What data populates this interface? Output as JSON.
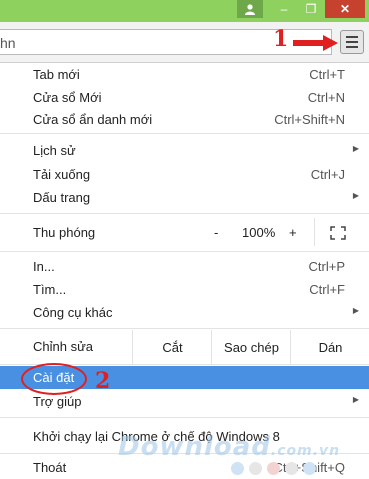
{
  "window": {
    "controls": {
      "minimize": "–",
      "maximize": "❐",
      "close": "✕"
    },
    "colors": {
      "titlebar": "#8fd15f",
      "close": "#c7412f",
      "highlight": "#4a90e2",
      "annotation": "#e02020"
    }
  },
  "omnibox": {
    "text": "hn"
  },
  "annotations": {
    "step1": "1",
    "step2": "2"
  },
  "menu": {
    "new_tab": {
      "label": "Tab mới",
      "shortcut": "Ctrl+T"
    },
    "new_window": {
      "label": "Cửa sổ Mới",
      "shortcut": "Ctrl+N"
    },
    "incognito": {
      "label": "Cửa sổ ẩn danh mới",
      "shortcut": "Ctrl+Shift+N"
    },
    "history": {
      "label": "Lịch sử"
    },
    "downloads": {
      "label": "Tải xuống",
      "shortcut": "Ctrl+J"
    },
    "bookmarks": {
      "label": "Dấu trang"
    },
    "zoom": {
      "label": "Thu phóng",
      "minus": "-",
      "value": "100%",
      "plus": "+"
    },
    "print": {
      "label": "In...",
      "shortcut": "Ctrl+P"
    },
    "find": {
      "label": "Tìm...",
      "shortcut": "Ctrl+F"
    },
    "more_tools": {
      "label": "Công cụ khác"
    },
    "edit": {
      "label": "Chỉnh sửa",
      "cut": "Cắt",
      "copy": "Sao chép",
      "paste": "Dán"
    },
    "settings": {
      "label": "Cài đặt"
    },
    "help": {
      "label": "Trợ giúp"
    },
    "relaunch": {
      "label": "Khởi chạy lại Chrome ở chế độ Windows 8"
    },
    "exit": {
      "label": "Thoát",
      "shortcut": "Ctrl+Shift+Q"
    }
  },
  "watermark": {
    "brand": "Download",
    "domain": ".com.vn"
  }
}
